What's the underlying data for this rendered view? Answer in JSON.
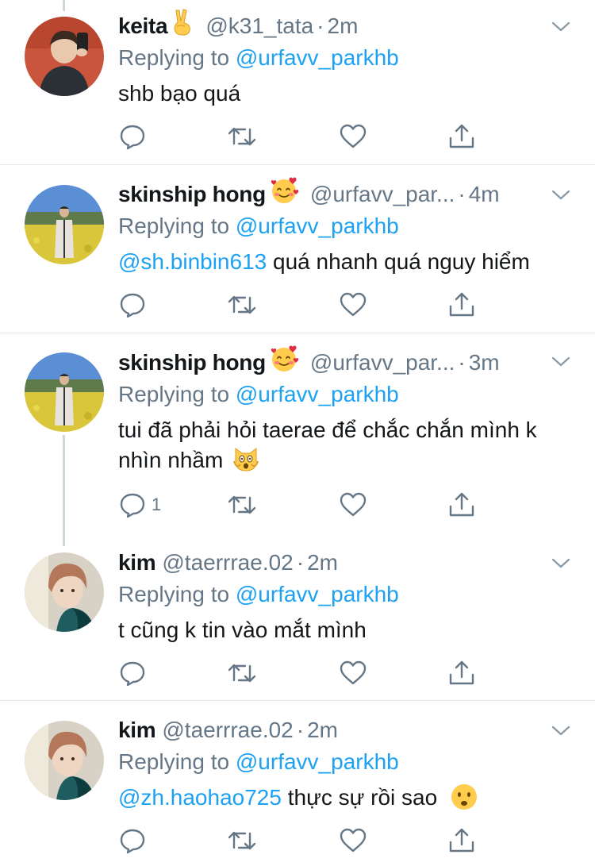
{
  "colors": {
    "link": "#1da1f2",
    "muted": "#657786",
    "text": "#14171a",
    "divider": "#e1e8ed"
  },
  "tweets": [
    {
      "name": "keita",
      "name_emoji": "victory-hand-icon",
      "handle": "@k31_tata",
      "dot": "·",
      "time": "2m",
      "replying_prefix": "Replying to",
      "replying_to": "@urfavv_parkhb",
      "body_mention": "",
      "body_text": "shb bạo quá",
      "reply_count": ""
    },
    {
      "name": "skinship hong",
      "name_emoji": "smiling-face-with-hearts-icon",
      "handle": "@urfavv_par...",
      "dot": "·",
      "time": "4m",
      "replying_prefix": "Replying to",
      "replying_to": "@urfavv_parkhb",
      "body_mention": "@sh.binbin613",
      "body_text": " quá nhanh quá nguy hiểm",
      "reply_count": ""
    },
    {
      "name": "skinship hong",
      "name_emoji": "smiling-face-with-hearts-icon",
      "handle": "@urfavv_par...",
      "dot": "·",
      "time": "3m",
      "replying_prefix": "Replying to",
      "replying_to": "@urfavv_parkhb",
      "body_mention": "",
      "body_text": "tui đã phải hỏi taerae để chắc chắn mình k nhìn nhầm",
      "body_emoji": "weary-cat-icon",
      "reply_count": "1"
    },
    {
      "name": "kim",
      "handle": "@taerrrae.02",
      "dot": "·",
      "time": "2m",
      "replying_prefix": "Replying to",
      "replying_to": "@urfavv_parkhb",
      "body_mention": "",
      "body_text": "t cũng k tin vào mắt mình",
      "reply_count": ""
    },
    {
      "name": "kim",
      "handle": "@taerrrae.02",
      "dot": "·",
      "time": "2m",
      "replying_prefix": "Replying to",
      "replying_to": "@urfavv_parkhb",
      "body_mention": "@zh.haohao725",
      "body_text": " thực sự rồi sao",
      "body_emoji": "frowning-face-icon",
      "reply_count": ""
    }
  ]
}
